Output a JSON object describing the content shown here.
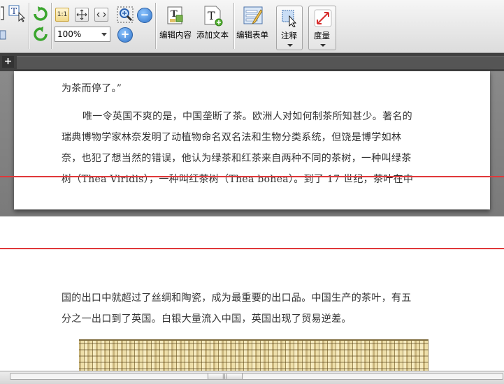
{
  "toolbar": {
    "zoom_value": "100%",
    "actual_size_label": "1:1",
    "edit_content_label": "编辑内容",
    "add_text_label": "添加文本",
    "edit_form_label": "编辑表单",
    "annotate_label": "注释",
    "measure_label": "度量",
    "add_text_icon_letter": "T",
    "edit_content_icon_letter": "T"
  },
  "tabs": {
    "add_label": "+"
  },
  "document": {
    "page1_lines": [
      "为茶而停了。”",
      "唯一令英国不爽的是，中国垄断了茶。欧洲人对如何制茶所知甚少。著名的",
      "瑞典博物学家林奈发明了动植物命名双名法和生物分类系统，但饶是博学如林",
      "奈，也犯了想当然的错误，他认为绿茶和红茶来自两种不同的茶树，一种叫绿茶",
      "树（Thea Viridis），一种叫红茶树（Thea bohea）。到了 17 世纪，茶叶在中"
    ],
    "page2_lines": [
      "国的出口中就超过了丝绸和陶瓷，成为最重要的出口品。中国生产的茶叶，有五",
      "分之一出口到了英国。白银大量流入中国，英国出现了贸易逆差。"
    ]
  },
  "colors": {
    "red_line": "#e0383a",
    "viewer_bg": "#808080",
    "text": "#333333"
  }
}
